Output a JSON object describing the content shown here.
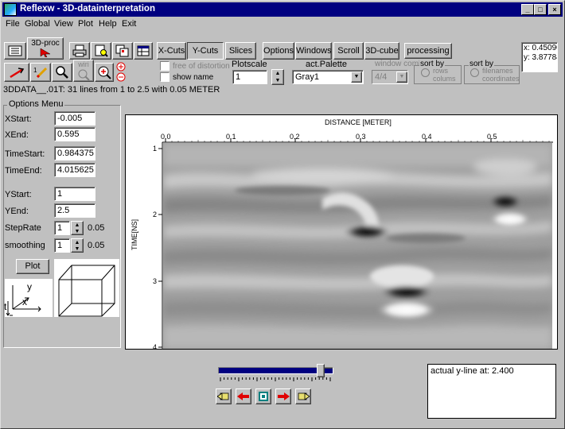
{
  "window": {
    "title": "Reflexw - 3D-datainterpretation",
    "min_label": "_",
    "max_label": "□",
    "close_label": "×"
  },
  "menu": [
    "File",
    "Global",
    "View",
    "Plot",
    "Help",
    "Exit"
  ],
  "toolbar": {
    "proc_label": "3D-proc",
    "wiri_label": "wiri",
    "x_cuts": "X-Cuts",
    "y_cuts": "Y-Cuts",
    "slices": "Slices",
    "options": "Options",
    "windows": "Windows",
    "scroll": "Scroll",
    "cube": "3D-cube",
    "processing": "processing",
    "free_of_distortion": "free of distortion",
    "show_name": "show name",
    "plotscale_label": "Plotscale",
    "plotscale_value": "1",
    "palette_label": "act.Palette",
    "palette_value": "Gray1",
    "window_comb_label": "window comb",
    "window_comb_value": "4/4",
    "sort_by_1": "sort by",
    "rows": "rows",
    "colums": "colums",
    "sort_by_2": "sort by",
    "filenames": "filenames",
    "coordinates": "coordinates",
    "coord_x": "x: 0.45090",
    "coord_y": "y: 3.87784"
  },
  "status_line": "3DDATA__.01T: 31 lines from 1 to 2.5 with 0.05 METER",
  "options_menu": {
    "title": "Options Menu",
    "xstart_label": "XStart:",
    "xstart_value": "-0.005",
    "xend_label": "XEnd:",
    "xend_value": "0.595",
    "timestart_label": "TimeStart:",
    "timestart_value": "0.984375",
    "timeend_label": "TimeEnd:",
    "timeend_value": "4.015625",
    "ystart_label": "YStart:",
    "ystart_value": "1",
    "yend_label": "YEnd:",
    "yend_value": "2.5",
    "steprate_label": "StepRate",
    "steprate_value": "1",
    "steprate_unit": "0.05",
    "smoothing_label": "smoothing",
    "smoothing_value": "1",
    "smoothing_unit": "0.05",
    "plot_button": "Plot",
    "axis_y": "y",
    "axis_x": "x",
    "axis_t": "t"
  },
  "plot": {
    "x_axis_title": "DISTANCE [METER]",
    "y_axis_title": "TIME[NS]",
    "x_ticks": [
      "0.0",
      "0.1",
      "0.2",
      "0.3",
      "0.4",
      "0.5"
    ],
    "y_ticks": [
      "1",
      "2",
      "3",
      "4"
    ]
  },
  "bottom": {
    "slider_fraction": 0.9,
    "info_text": "actual y-line at: 2.400"
  },
  "colors": {
    "titlebar": "#000080",
    "slider_fill": "#000080",
    "arrow_red": "#e00000",
    "face": "#c0c0c0"
  }
}
